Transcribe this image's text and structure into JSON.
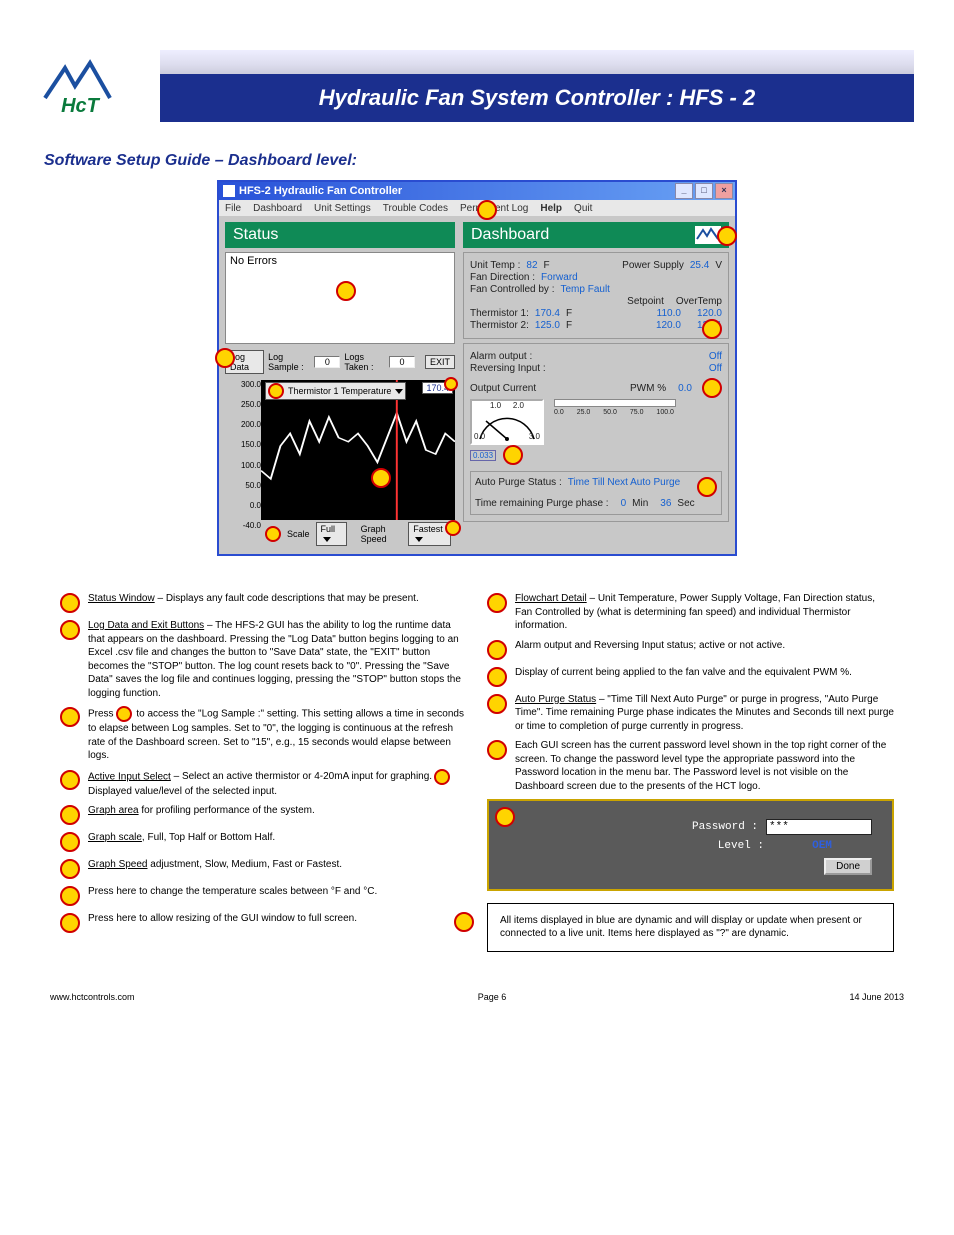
{
  "header": {
    "title": "Hydraulic Fan System Controller : HFS - 2",
    "section_title": "Software Setup Guide – Dashboard level:"
  },
  "window": {
    "title": "HFS-2 Hydraulic Fan Controller",
    "menu": [
      "File",
      "Dashboard",
      "Unit Settings",
      "Trouble Codes",
      "Permanent Log",
      "Help",
      "Quit"
    ],
    "menu_bold_index": 5
  },
  "status_panel": {
    "heading": "Status",
    "text": "No Errors",
    "log_data_btn": "Log Data",
    "log_sample_label": "Log Sample :",
    "log_sample_value": "0",
    "logs_taken_label": "Logs Taken :",
    "logs_taken_value": "0",
    "exit_btn": "EXIT",
    "therm_select": "Thermistor 1 Temperature",
    "therm_value": "170.4",
    "y_axis": [
      "300.0",
      "250.0",
      "200.0",
      "150.0",
      "100.0",
      "50.0",
      "0.0",
      "-40.0"
    ],
    "scale_label": "Scale",
    "scale_value": "Full",
    "speed_label": "Graph Speed",
    "speed_value": "Fastest"
  },
  "dashboard_panel": {
    "heading": "Dashboard",
    "unit_temp_label": "Unit Temp :",
    "unit_temp_value": "82",
    "unit_temp_unit": "F",
    "power_label": "Power Supply",
    "power_value": "25.4",
    "power_unit": "V",
    "fan_dir_label": "Fan Direction :",
    "fan_dir_value": "Forward",
    "fan_ctrl_label": "Fan Controlled by :",
    "fan_ctrl_value": "Temp Fault",
    "col_setpoint": "Setpoint",
    "col_overtemp": "OverTemp",
    "th1_label": "Thermistor 1:",
    "th1_val": "170.4",
    "th1_unit": "F",
    "th1_set": "110.0",
    "th1_over": "120.0",
    "th2_label": "Thermistor 2:",
    "th2_val": "125.0",
    "th2_unit": "F",
    "th2_set": "120.0",
    "th2_over": "130.1",
    "alarm_label": "Alarm output :",
    "alarm_value": "Off",
    "rev_label": "Reversing Input :",
    "rev_value": "Off",
    "out_cur_label": "Output Current",
    "pwm_label": "PWM %",
    "pwm_value": "0.0",
    "gauge_ticks": [
      "0.0",
      "1.0",
      "2.0",
      "3.0"
    ],
    "gauge_value": "0.033",
    "slider_ticks": [
      "0.0",
      "25.0",
      "50.0",
      "75.0",
      "100.0"
    ],
    "purge_status_label": "Auto Purge Status :",
    "purge_status_value": "Time Till Next Auto Purge",
    "purge_time_label": "Time remaining Purge phase :",
    "purge_min": "0",
    "purge_min_unit": "Min",
    "purge_sec": "36",
    "purge_sec_unit": "Sec"
  },
  "desc_left": [
    {
      "title": "Status Window",
      "body": " – Displays any fault code descriptions that may be present."
    },
    {
      "title": "Log Data and Exit Buttons",
      "body": " – The HFS-2 GUI has the ability to log the runtime data that appears on the dashboard. Pressing the \"Log Data\" button begins logging to an Excel .csv file and changes the button to \"Save Data\" state, the \"EXIT\" button becomes the \"STOP\" button. The log count resets back to \"0\". Pressing the \"Save Data\" saves the log file and continues logging, pressing the \"STOP\" button stops the logging function."
    },
    {
      "title": "",
      "body": "Press           to access the \"Log Sample :\" setting. This setting allows a time in seconds to elapse between Log samples. Set to \"0\", the logging is continuous at the refresh rate of the Dashboard screen. Set to \"15\", e.g., 15 seconds would elapse between logs.",
      "inline_marker": true
    },
    {
      "title": "Active Input Select",
      "body": " – Select an active thermistor or 4-20mA input for graphing.      Displayed value/level of the selected input."
    },
    {
      "title": "Graph area",
      "body": " for profiling performance of the system."
    },
    {
      "title": "Graph scale",
      "body": ", Full, Top Half or Bottom Half."
    },
    {
      "title": "Graph Speed",
      "body": " adjustment, Slow, Medium, Fast or Fastest."
    },
    {
      "title": "",
      "body": "Press here to change the temperature scales between °F and °C."
    },
    {
      "title": "",
      "body": "Press here to allow resizing of the GUI window to full screen."
    }
  ],
  "desc_right": [
    {
      "title": "Flowchart Detail",
      "body": " – Unit Temperature, Power Supply Voltage, Fan Direction status, Fan Controlled by (what is determining fan speed) and individual Thermistor information."
    },
    {
      "title": "",
      "body": "Alarm output and Reversing Input status; active or not active."
    },
    {
      "title": "",
      "body": "Display of current being applied to the fan valve and the equivalent PWM %."
    },
    {
      "title": "Auto Purge Status",
      "body": " – \"Time Till Next Auto Purge\" or purge in progress, \"Auto Purge Time\". Time remaining Purge phase indicates the Minutes and Seconds till next purge or time to completion of purge currently in progress."
    },
    {
      "title": "",
      "body": "Each GUI screen has the current password level shown in the top right corner of the screen. To change the password level type the appropriate password into the Password location in the menu bar. The Password level is not visible on the Dashboard screen due to the presents of the HCT logo."
    }
  ],
  "password_box": {
    "k_password": "Password :",
    "value_masked": "***",
    "k_level": "Level :",
    "level_value": "OEM",
    "done": "Done"
  },
  "note_box": {
    "text": "All items displayed in blue are dynamic and will display or update when present or connected to a live unit. Items here displayed as \"?\" are dynamic."
  },
  "footer": {
    "left": "www.hctcontrols.com",
    "center": "Page 6",
    "right": "14 June 2013"
  },
  "chart_data": {
    "type": "line",
    "title": "Thermistor 1 Temperature",
    "ylabel": "°F",
    "ylim": [
      -40,
      300
    ],
    "y_ticks": [
      -40,
      0,
      50,
      100,
      150,
      200,
      250,
      300
    ],
    "x": [
      0,
      5,
      10,
      15,
      20,
      25,
      30,
      35,
      40,
      45,
      50,
      55,
      60,
      65,
      70,
      75,
      80,
      85,
      90,
      95,
      100
    ],
    "values": [
      80,
      60,
      140,
      170,
      120,
      200,
      150,
      210,
      160,
      150,
      170,
      140,
      100,
      160,
      220,
      150,
      200,
      130,
      120,
      170,
      150
    ],
    "cursor_x": 70,
    "cursor_value": 170.4
  }
}
